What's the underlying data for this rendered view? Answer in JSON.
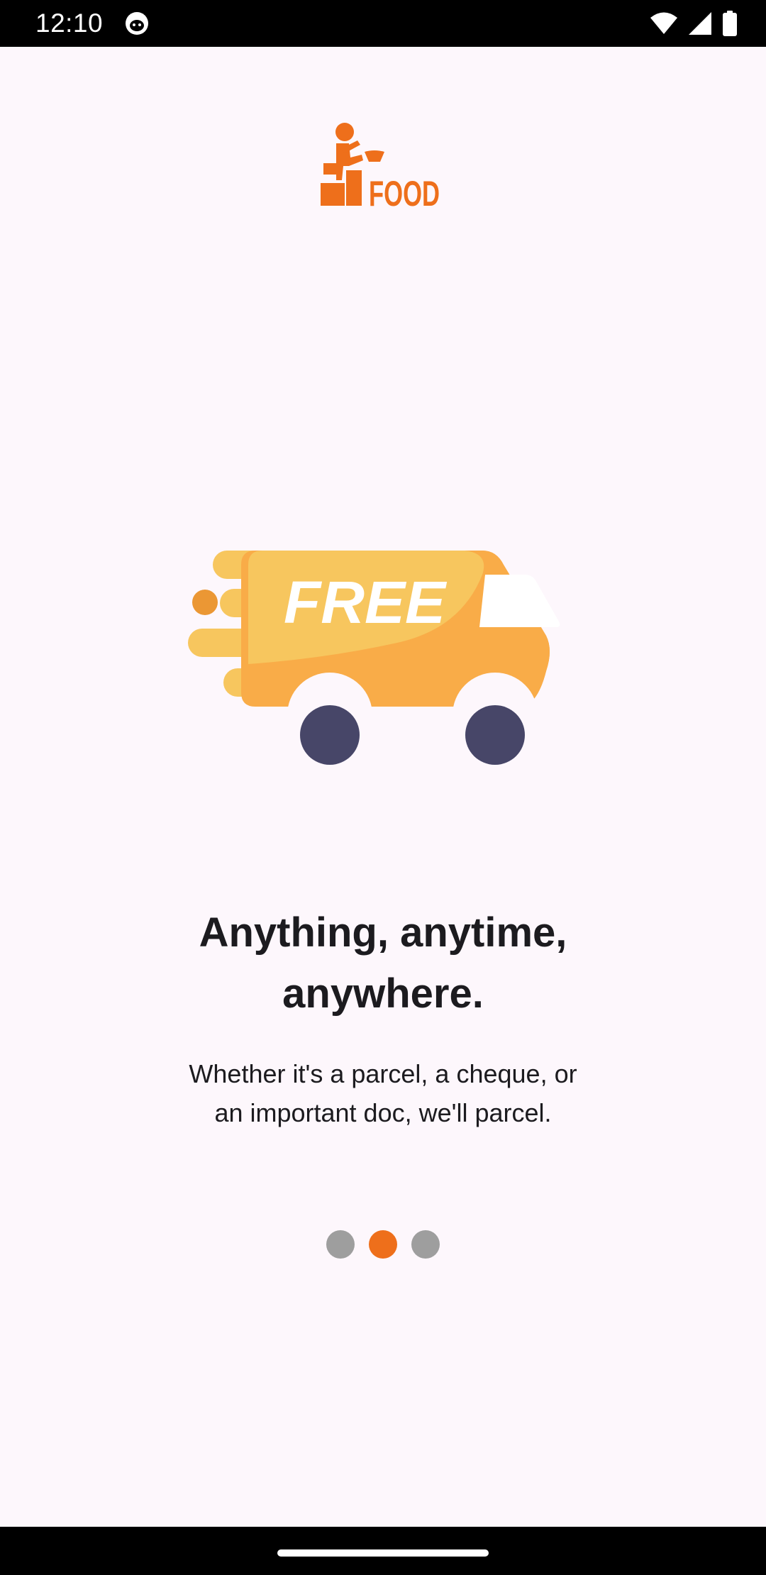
{
  "status_bar": {
    "time": "12:10",
    "app_icon": "cat-notification-icon",
    "icons": [
      "wifi-icon",
      "cellular-signal-icon",
      "battery-icon"
    ]
  },
  "logo": {
    "text": "FOOD",
    "color": "#EE6F1B"
  },
  "illustration": {
    "badge_text": "FREE",
    "icon": "delivery-truck-icon"
  },
  "onboarding": {
    "title_line1": "Anything, anytime,",
    "title_line2": "anywhere.",
    "subtitle_line1": "Whether it's a parcel, a cheque, or",
    "subtitle_line2": "an important doc, we'll parcel."
  },
  "pager": {
    "total_pages": 3,
    "current_page": 2
  },
  "colors": {
    "accent": "#EE6F1B",
    "inactive_dot": "#9E9E9E",
    "background": "#FDF7FC",
    "text": "#1C1B1F",
    "truck_body": "#F9AC48",
    "truck_light": "#F7C65E",
    "wheel": "#474668"
  }
}
